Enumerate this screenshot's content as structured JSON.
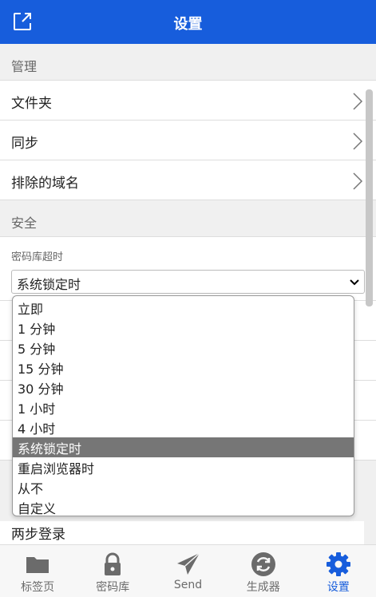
{
  "header": {
    "title": "设置"
  },
  "sections": {
    "manage": {
      "title": "管理",
      "items": [
        "文件夹",
        "同步",
        "排除的域名"
      ]
    },
    "security": {
      "title": "安全",
      "vault_timeout": {
        "label": "密码库超时",
        "value": "系统锁定时"
      }
    }
  },
  "last_row_label": "两步登录",
  "dropdown": {
    "options": [
      "立即",
      "1 分钟",
      "5 分钟",
      "15 分钟",
      "30 分钟",
      "1 小时",
      "4 小时",
      "系统锁定时",
      "重启浏览器时",
      "从不",
      "自定义"
    ],
    "selected": "系统锁定时"
  },
  "tabs": [
    {
      "label": "标签页",
      "icon": "folder-icon"
    },
    {
      "label": "密码库",
      "icon": "lock-icon"
    },
    {
      "label": "Send",
      "icon": "send-icon"
    },
    {
      "label": "生成器",
      "icon": "refresh-icon"
    },
    {
      "label": "设置",
      "icon": "gear-icon",
      "active": true
    }
  ],
  "colors": {
    "brand": "#175ddc",
    "selected_option": "#767676"
  }
}
